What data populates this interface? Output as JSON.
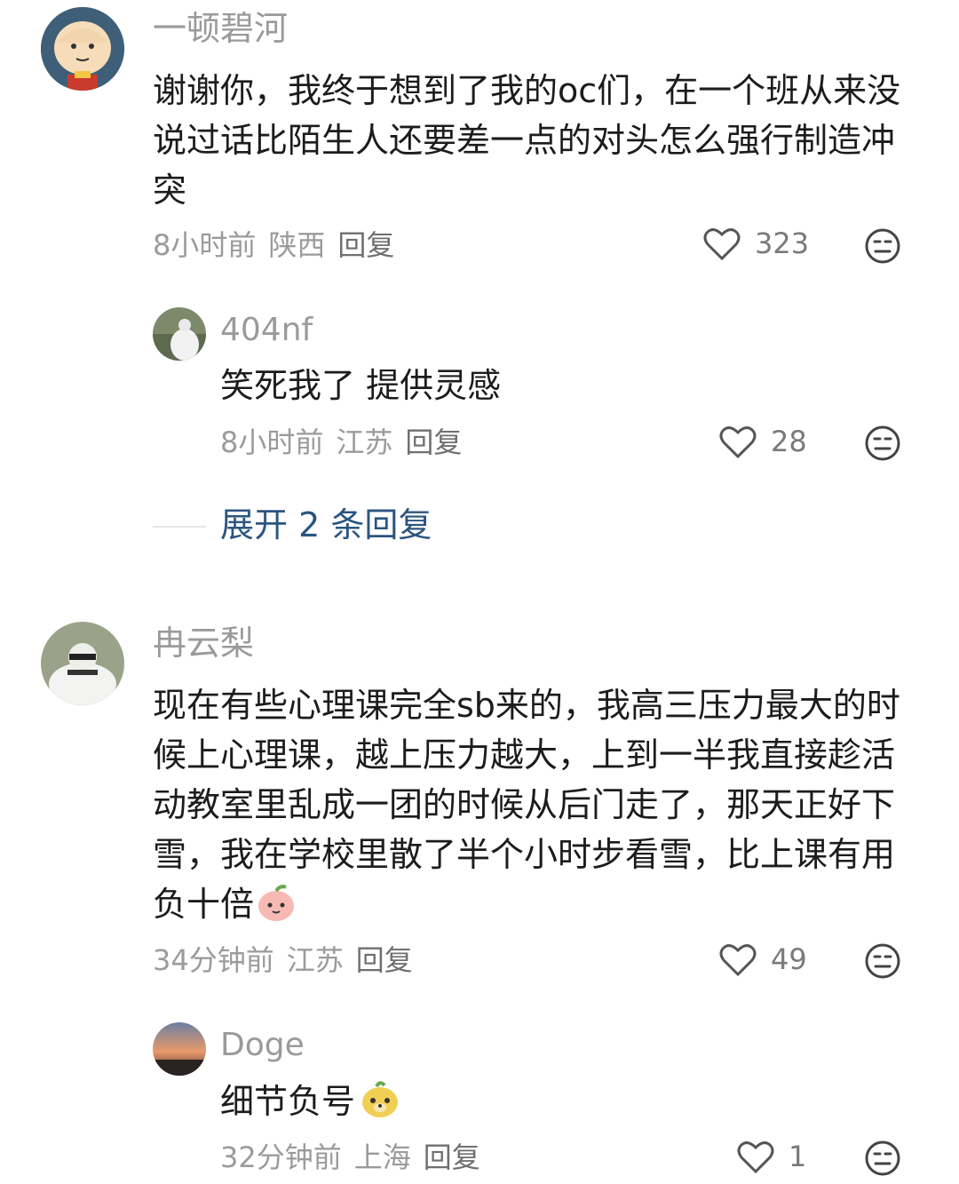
{
  "comments": [
    {
      "username": "一顿碧河",
      "content": "谢谢你，我终于想到了我的oc们，在一个班从来没说过话比陌生人还要差一点的对头怎么强行制造冲突",
      "time": "8小时前",
      "location": "陕西",
      "reply_label": "回复",
      "likes": "323",
      "replies": [
        {
          "username": "404nf",
          "content": "笑死我了 提供灵感",
          "time": "8小时前",
          "location": "江苏",
          "reply_label": "回复",
          "likes": "28"
        }
      ],
      "expand_label": "展开 2 条回复"
    },
    {
      "username": "冉云梨",
      "content": "现在有些心理课完全sb来的，我高三压力最大的时候上心理课，越上压力越大，上到一半我直接趁活动教室里乱成一团的时候从后门走了，那天正好下雪，我在学校里散了半个小时步看雪，比上课有用负十倍",
      "time": "34分钟前",
      "location": "江苏",
      "reply_label": "回复",
      "likes": "49",
      "replies": [
        {
          "username": "Doge",
          "content": "细节负号",
          "time": "32分钟前",
          "location": "上海",
          "reply_label": "回复",
          "likes": "1"
        }
      ]
    }
  ],
  "icons": {
    "like": "heart-outline-icon",
    "dislike": "neutral-face-icon",
    "emoji1": "peach-face-emoji",
    "emoji2": "doge-face-emoji"
  },
  "colors": {
    "link": "#2b5580",
    "meta": "#9b9b9b",
    "text": "#1c1c1c"
  }
}
